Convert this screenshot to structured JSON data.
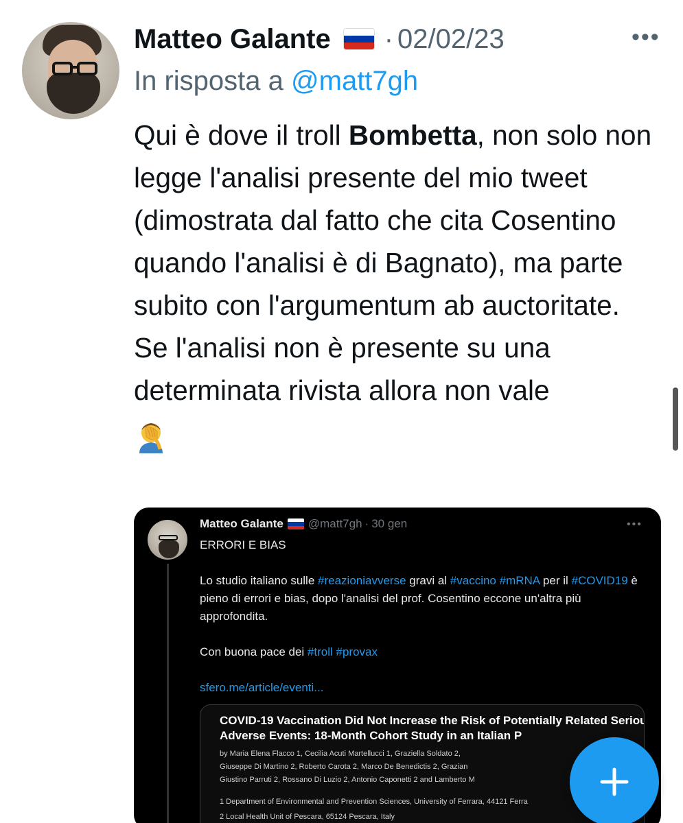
{
  "tweet": {
    "author_name": "Matteo Galante",
    "author_flag": "russia-flag",
    "separator": "·",
    "date": "02/02/23",
    "more_icon": "more-horizontal-icon",
    "reply_prefix": "In risposta a",
    "reply_handle": "@matt7gh",
    "text_1": "Qui è dove il troll ",
    "text_bold": "Bombetta",
    "text_2": ", non solo non legge l'analisi presente del mio tweet (dimostrata dal fatto che cita Cosentino quando l'analisi è di Bagnato), ma parte subito con l'argumentum ab auctoritate.",
    "text_3": "Se l'analisi non è presente su una determinata rivista allora non vale",
    "emoji": "facepalm-emoji"
  },
  "quoted": {
    "author_name": "Matteo Galante",
    "handle": "@matt7gh",
    "separator": "·",
    "date": "30 gen",
    "line_1": "ERRORI E BIAS",
    "p2_a": "Lo studio italiano sulle ",
    "p2_h1": "#reazioniavverse",
    "p2_b": " gravi al ",
    "p2_h2": "#vaccino",
    "p2_h3": "#mRNA",
    "p2_c": " per il ",
    "p2_h4": "#COVID19",
    "p2_d": " è pieno di errori e bias, dopo l'analisi del prof. Cosentino eccone un'altra più approfondita.",
    "p3_a": "Con buona pace dei ",
    "p3_h1": "#troll",
    "p3_h2": "#provax",
    "link": "sfero.me/article/eventi...",
    "card": {
      "title": "COVID-19 Vaccination Did Not Increase the Risk of Potentially Related Serious Adverse Events: 18-Month Cohort Study in an Italian P",
      "authors_1": "by  Maria Elena Flacco 1,  Cecilia Acuti Martellucci 1,  Graziella Soldato 2,",
      "authors_2": "Giuseppe Di Martino 2,  Roberto Carota 2,  Marco De Benedictis 2,  Grazian",
      "authors_3": "Giustino Parruti 2,  Rossano Di Luzio 2,  Antonio Caponetti 2 and  Lamberto M",
      "aff_1": "1  Department of Environmental and Prevention Sciences, University of Ferrara, 44121 Ferra",
      "aff_2": "2  Local Health Unit of Pescara, 65124 Pescara, Italy"
    }
  },
  "fab": {
    "icon": "plus-icon"
  },
  "colors": {
    "accent": "#1d9bf0",
    "secondary_text": "#536471",
    "embed_bg": "#000000"
  }
}
